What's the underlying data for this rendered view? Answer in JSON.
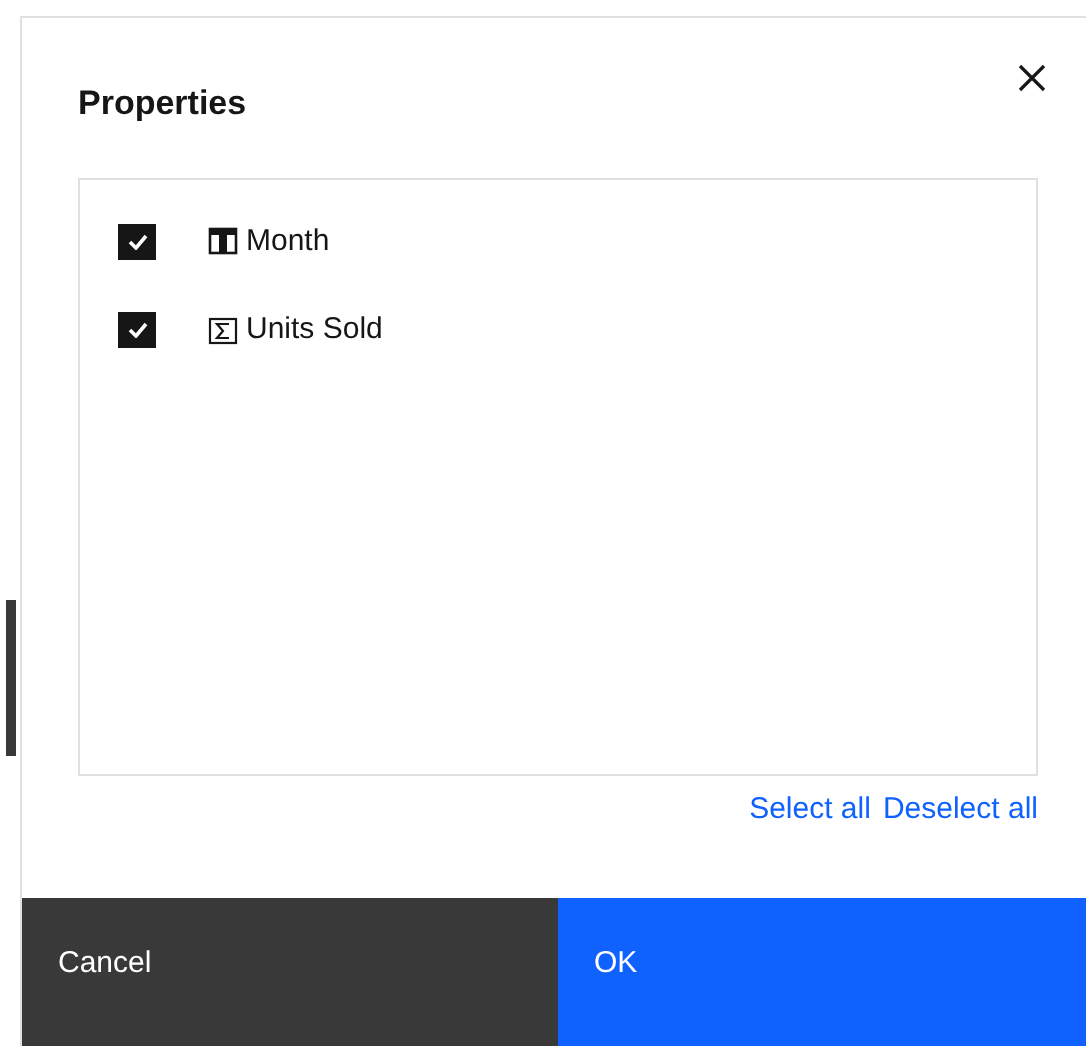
{
  "dialog": {
    "title": "Properties",
    "items": [
      {
        "label": "Month",
        "kind": "dimension",
        "checked": true
      },
      {
        "label": "Units Sold",
        "kind": "measure",
        "checked": true
      }
    ],
    "links": [
      "Select all",
      "Deselect all"
    ],
    "buttons": [
      {
        "label": "Cancel",
        "kind": "secondary"
      },
      {
        "label": "OK",
        "kind": "primary"
      }
    ]
  }
}
